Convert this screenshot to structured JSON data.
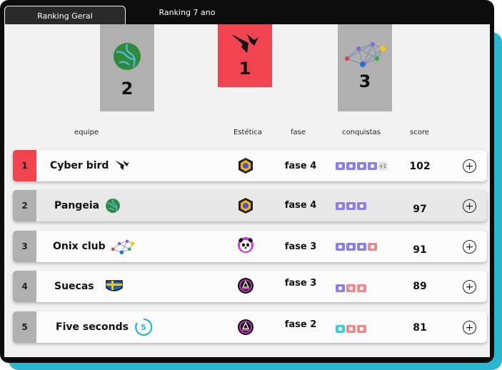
{
  "tabs": [
    {
      "label": "Ranking Geral",
      "active": true
    },
    {
      "label": "Ranking 7 ano",
      "active": false
    }
  ],
  "podium": [
    {
      "place": "2",
      "team_icon": "globe-icon"
    },
    {
      "place": "1",
      "team_icon": "origami-bird-icon"
    },
    {
      "place": "3",
      "team_icon": "network-icon"
    }
  ],
  "headers": {
    "equipe": "equipe",
    "estetica": "Estética",
    "fase": "fase",
    "conquistas": "conquistas",
    "score": "score"
  },
  "rows": [
    {
      "rank": "1",
      "name": "Cyber bird",
      "icon": "origami-bird-icon",
      "badge": "hexagon-badge",
      "fase": "fase 4",
      "achievements": [
        "purple",
        "purple",
        "purple",
        "purple"
      ],
      "extra": "+1",
      "score": "102"
    },
    {
      "rank": "2",
      "name": "Pangeia",
      "icon": "globe-icon",
      "badge": "hexagon-badge",
      "fase": "fase 4",
      "achievements": [
        "purple",
        "purple",
        "purple"
      ],
      "extra": "",
      "score": "97"
    },
    {
      "rank": "3",
      "name": "Onix club",
      "icon": "network-icon",
      "badge": "panda-badge",
      "fase": "fase 3",
      "achievements": [
        "purple",
        "purple",
        "purple",
        "pink"
      ],
      "extra": "",
      "score": "91"
    },
    {
      "rank": "4",
      "name": "Suecas",
      "icon": "sweden-flag-icon",
      "badge": "neon-badge",
      "fase": "fase 3",
      "achievements": [
        "purple",
        "pink",
        "pink"
      ],
      "extra": "",
      "score": "89"
    },
    {
      "rank": "5",
      "name": "Five seconds",
      "icon": "timer-five-icon",
      "badge": "neon-badge",
      "fase": "fase 2",
      "achievements": [
        "teal",
        "pink",
        "pink"
      ],
      "extra": "",
      "score": "81"
    }
  ],
  "colors": {
    "accent_red": "#f04450",
    "podium_gray": "#b0b0b0",
    "shadow_teal": "#2bb6d0",
    "chip_purple": "#8a7ef0",
    "chip_pink": "#f08a8a",
    "chip_teal": "#3cd0dc"
  }
}
